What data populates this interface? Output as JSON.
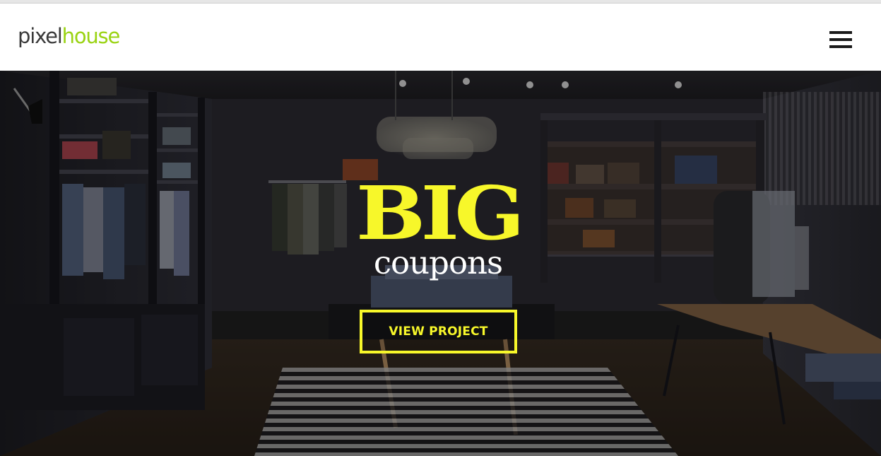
{
  "brand": {
    "logo_part1": "pixel",
    "logo_part2": "house"
  },
  "hero": {
    "headline_big": "BIG",
    "headline_sub": "coupons",
    "cta_label": "VIEW PROJECT"
  },
  "icons": {
    "menu": "hamburger-menu-icon"
  },
  "colors": {
    "accent_yellow": "#f7f72a",
    "logo_green": "#9ad313",
    "logo_gray": "#3a3a3a",
    "headline_white": "#ffffff"
  }
}
